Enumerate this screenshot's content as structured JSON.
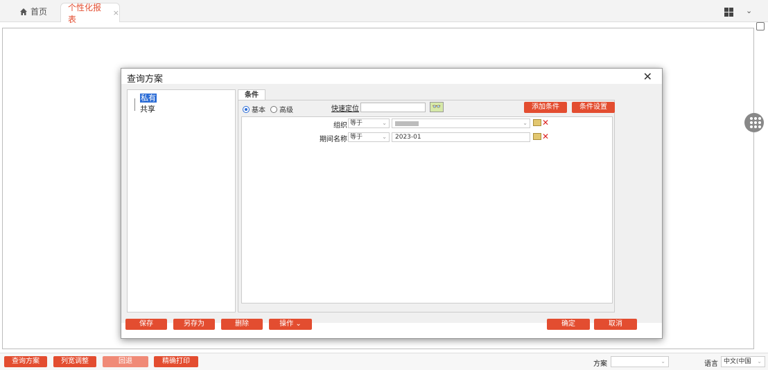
{
  "tabs": {
    "home": "首页",
    "active": "个性化报表",
    "close": "×"
  },
  "dialog": {
    "title": "查询方案",
    "close": "✕",
    "tree": {
      "private": "私有",
      "shared": "共享"
    },
    "condition_tab": "条件",
    "radio": {
      "basic": "基本",
      "advanced": "高级",
      "selected": "basic"
    },
    "quick_locate_label": "快速定位",
    "quick_locate_value": "",
    "add_condition": "添加条件",
    "condition_settings": "条件设置",
    "rows": [
      {
        "label": "组织",
        "operator": "等于",
        "value": ""
      },
      {
        "label": "期间名称",
        "operator": "等于",
        "value": "2023-01"
      }
    ],
    "footer": {
      "save": "保存",
      "save_as": "另存为",
      "delete": "删除",
      "operate": "操作",
      "ok": "确定",
      "cancel": "取消"
    }
  },
  "bottom": {
    "query_scheme": "查询方案",
    "col_width": "列宽调整",
    "rollback": "回退",
    "precise_print": "精确打印",
    "scheme_label": "方案",
    "scheme_value": "",
    "lang_label": "语言",
    "lang_value": "中文(中国"
  },
  "colors": {
    "accent": "#e34d30",
    "accent_disabled": "#f08a77",
    "selection": "#2b6cd6"
  }
}
